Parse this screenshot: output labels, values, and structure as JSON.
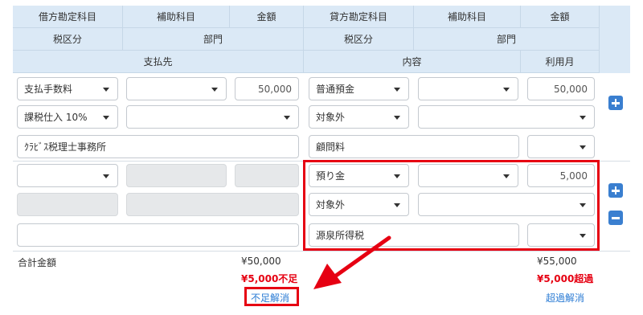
{
  "header": {
    "debit_account": "借方勘定科目",
    "debit_sub": "補助科目",
    "debit_amount": "金額",
    "credit_account": "貸方勘定科目",
    "credit_sub": "補助科目",
    "credit_amount": "金額",
    "debit_tax": "税区分",
    "debit_dept": "部門",
    "credit_tax": "税区分",
    "credit_dept": "部門",
    "payee": "支払先",
    "content": "内容",
    "usage_month": "利用月"
  },
  "entry1": {
    "debit_account": "支払手数料",
    "debit_sub": "",
    "debit_amount": "50,000",
    "credit_account": "普通預金",
    "credit_sub": "",
    "credit_amount": "50,000",
    "debit_tax": "課税仕入 10%",
    "debit_dept": "",
    "credit_tax": "対象外",
    "credit_dept": "",
    "payee": "ｸﾗﾋﾞｽ税理士事務所",
    "content": "顧問料",
    "usage_month": ""
  },
  "entry2": {
    "debit_account": "",
    "credit_account": "預り金",
    "credit_sub": "",
    "credit_amount": "5,000",
    "credit_tax": "対象外",
    "credit_dept": "",
    "payee": "",
    "content": "源泉所得税",
    "usage_month": ""
  },
  "totals": {
    "label": "合計金額",
    "debit_total": "¥50,000",
    "debit_status": "¥5,000不足",
    "debit_link": "不足解消",
    "credit_total": "¥55,000",
    "credit_status": "¥5,000超過",
    "credit_link": "超過解消"
  },
  "colors": {
    "header_bg": "#dbe9f6",
    "accent_blue": "#3a7fd0",
    "highlight_red": "#e60012",
    "link_blue": "#2a7bd4"
  }
}
